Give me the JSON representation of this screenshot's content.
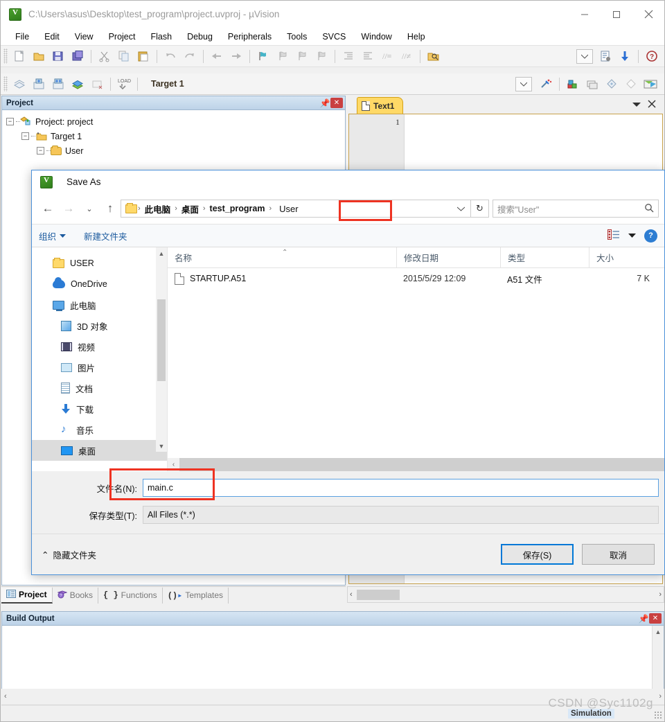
{
  "app": {
    "title": "C:\\Users\\asus\\Desktop\\test_program\\project.uvproj - µVision",
    "menu": [
      "File",
      "Edit",
      "View",
      "Project",
      "Flash",
      "Debug",
      "Peripherals",
      "Tools",
      "SVCS",
      "Window",
      "Help"
    ],
    "target_label": "Target 1"
  },
  "project_panel": {
    "caption": "Project",
    "tree": [
      {
        "label": "Project: project",
        "depth": 0
      },
      {
        "label": "Target 1",
        "depth": 1
      },
      {
        "label": "User",
        "depth": 2
      }
    ]
  },
  "editor": {
    "tab_label": "Text1",
    "line_number": "1"
  },
  "bottom_tabs": [
    {
      "label": "Project",
      "active": true
    },
    {
      "label": "Books",
      "active": false
    },
    {
      "label": "Functions",
      "active": false
    },
    {
      "label": "Templates",
      "active": false
    }
  ],
  "build_output": {
    "caption": "Build Output"
  },
  "status": {
    "simulation": "Simulation"
  },
  "watermark": "CSDN @Syc1102g",
  "dialog": {
    "title": "Save As",
    "breadcrumb": {
      "items": [
        "此电脑",
        "桌面",
        "test_program"
      ],
      "current": "User",
      "separator": "›"
    },
    "search": {
      "placeholder": "搜索\"User\""
    },
    "commands": {
      "organize": "组织",
      "new_folder": "新建文件夹"
    },
    "nav_items": [
      {
        "label": "USER",
        "icon": "folder-icon",
        "indent": false,
        "selected": false
      },
      {
        "label": "OneDrive",
        "icon": "cloud-icon",
        "indent": false,
        "selected": false
      },
      {
        "label": "此电脑",
        "icon": "computer-icon",
        "indent": false,
        "selected": false
      },
      {
        "label": "3D 对象",
        "icon": "cube-icon",
        "indent": true,
        "selected": false
      },
      {
        "label": "视频",
        "icon": "video-icon",
        "indent": true,
        "selected": false
      },
      {
        "label": "图片",
        "icon": "picture-icon",
        "indent": true,
        "selected": false
      },
      {
        "label": "文档",
        "icon": "document-icon",
        "indent": true,
        "selected": false
      },
      {
        "label": "下载",
        "icon": "download-icon",
        "indent": true,
        "selected": false
      },
      {
        "label": "音乐",
        "icon": "music-icon",
        "indent": true,
        "selected": false
      },
      {
        "label": "桌面",
        "icon": "desktop-icon",
        "indent": true,
        "selected": true
      }
    ],
    "columns": [
      "名称",
      "修改日期",
      "类型",
      "大小"
    ],
    "files": [
      {
        "name": "STARTUP.A51",
        "modified": "2015/5/29 12:09",
        "type": "A51 文件",
        "size": "7 K"
      }
    ],
    "filename_label": "文件名(N):",
    "filename_value": "main.c",
    "filetype_label": "保存类型(T):",
    "filetype_value": "All Files (*.*)",
    "hide_folders": "隐藏文件夹",
    "save_button": "保存(S)",
    "cancel_button": "取消"
  },
  "colors": {
    "accent_blue": "#0078d7",
    "highlight_red": "#ee3322",
    "tab_yellow": "#ffd966",
    "panel_caption": "#bdd3e8"
  }
}
